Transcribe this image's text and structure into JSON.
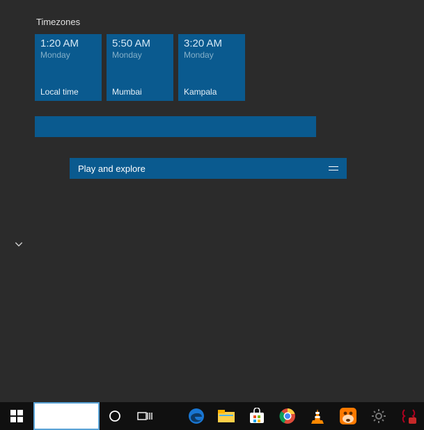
{
  "colors": {
    "tile": "#0a5a8f",
    "background": "#2b2b2b",
    "taskbar": "#101010"
  },
  "group_title": "Timezones",
  "tiles": [
    {
      "time": "1:20 AM",
      "day": "Monday",
      "label": "Local time"
    },
    {
      "time": "5:50 AM",
      "day": "Monday",
      "label": "Mumbai"
    },
    {
      "time": "3:20 AM",
      "day": "Monday",
      "label": "Kampala"
    }
  ],
  "play_bar": {
    "label": "Play and explore"
  },
  "taskbar_icons": {
    "start": "start-icon",
    "cortana": "cortana-icon",
    "taskview": "task-view-icon",
    "edge": "edge-icon",
    "explorer": "file-explorer-icon",
    "store": "store-icon",
    "chrome": "chrome-icon",
    "vlc": "vlc-icon",
    "uc": "uc-browser-icon",
    "settings": "settings-gear-icon",
    "lastitem": "notification-icon"
  }
}
